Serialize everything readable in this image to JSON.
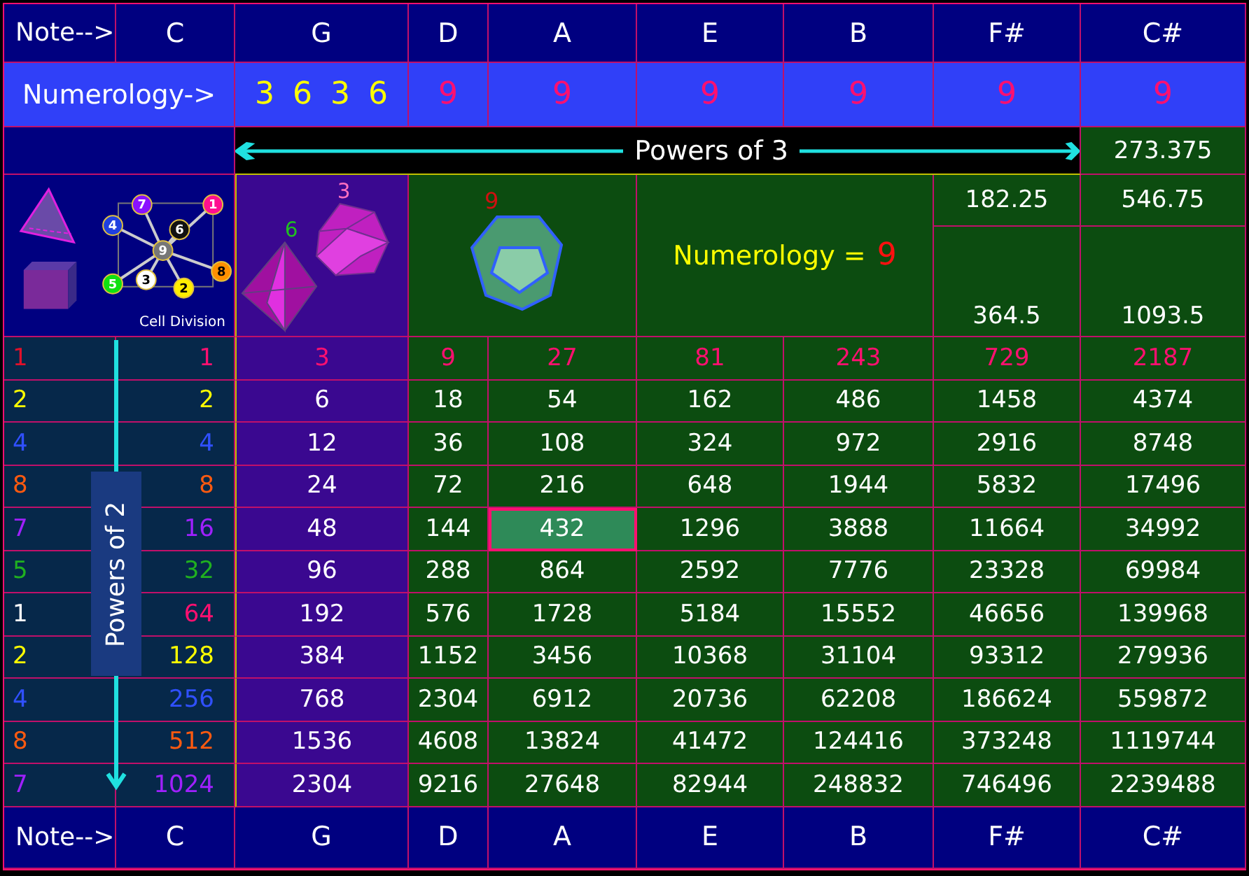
{
  "header": {
    "label": "Note-->",
    "notes": [
      "C",
      "G",
      "D",
      "A",
      "E",
      "B",
      "F#",
      "C#"
    ]
  },
  "numerology": {
    "label": "Numerology->",
    "values": [
      {
        "text": "3 6 3 6",
        "color": "#ffff00"
      },
      {
        "text": "9",
        "color": "#ff1070"
      },
      {
        "text": "9",
        "color": "#ff1070"
      },
      {
        "text": "9",
        "color": "#ff1070"
      },
      {
        "text": "9",
        "color": "#ff1070"
      },
      {
        "text": "9",
        "color": "#ff1070"
      },
      {
        "text": "9",
        "color": "#ff1070"
      }
    ]
  },
  "powers_of_3": {
    "label": "Powers of 3",
    "value": "273.375"
  },
  "figures": {
    "caption": "Cell Division",
    "nodes": [
      {
        "text": "7",
        "color": "#8a10ff"
      },
      {
        "text": "1",
        "color": "#ff1090"
      },
      {
        "text": "4",
        "color": "#2040e0"
      },
      {
        "text": "6",
        "color": "#111111"
      },
      {
        "text": "9",
        "color": "#777777"
      },
      {
        "text": "3",
        "color": "#ffffff"
      },
      {
        "text": "8",
        "color": "#ff9000"
      },
      {
        "text": "5",
        "color": "#10e010"
      },
      {
        "text": "2",
        "color": "#ffee00"
      }
    ],
    "icosahedron_number": "3",
    "octahedron_number": "6",
    "dodecahedron_number": "9"
  },
  "numerology_sum": {
    "label": "Numerology =",
    "value": "9"
  },
  "fractions": {
    "f_sharp": [
      "182.25",
      "364.5"
    ],
    "c_sharp": [
      "546.75",
      "1093.5"
    ]
  },
  "rows": [
    {
      "kind": "base",
      "root": {
        "text": "1",
        "color": "#e0102a"
      },
      "power": {
        "text": "1",
        "color": "#ff1070"
      },
      "values": [
        {
          "text": "3",
          "selected": false
        },
        {
          "text": "9",
          "selected": false
        },
        {
          "text": "27",
          "selected": false
        },
        {
          "text": "81",
          "selected": false
        },
        {
          "text": "243",
          "selected": false
        },
        {
          "text": "729",
          "selected": false
        },
        {
          "text": "2187",
          "selected": false
        }
      ]
    },
    {
      "kind": "multiple",
      "root": {
        "text": "2",
        "color": "#ffff00"
      },
      "power": {
        "text": "2",
        "color": "#ffff00"
      },
      "values": [
        {
          "text": "6",
          "selected": false
        },
        {
          "text": "18",
          "selected": false
        },
        {
          "text": "54",
          "selected": false
        },
        {
          "text": "162",
          "selected": false
        },
        {
          "text": "486",
          "selected": false
        },
        {
          "text": "1458",
          "selected": false
        },
        {
          "text": "4374",
          "selected": false
        }
      ]
    },
    {
      "kind": "multiple",
      "root": {
        "text": "4",
        "color": "#3050ff"
      },
      "power": {
        "text": "4",
        "color": "#3050ff"
      },
      "values": [
        {
          "text": "12",
          "selected": false
        },
        {
          "text": "36",
          "selected": false
        },
        {
          "text": "108",
          "selected": false
        },
        {
          "text": "324",
          "selected": false
        },
        {
          "text": "972",
          "selected": false
        },
        {
          "text": "2916",
          "selected": false
        },
        {
          "text": "8748",
          "selected": false
        }
      ]
    },
    {
      "kind": "multiple",
      "root": {
        "text": "8",
        "color": "#ff5a10"
      },
      "power": {
        "text": "8",
        "color": "#ff5a10"
      },
      "values": [
        {
          "text": "24",
          "selected": false
        },
        {
          "text": "72",
          "selected": false
        },
        {
          "text": "216",
          "selected": false
        },
        {
          "text": "648",
          "selected": false
        },
        {
          "text": "1944",
          "selected": false
        },
        {
          "text": "5832",
          "selected": false
        },
        {
          "text": "17496",
          "selected": false
        }
      ]
    },
    {
      "kind": "multiple",
      "root": {
        "text": "7",
        "color": "#a020ff"
      },
      "power": {
        "text": "16",
        "color": "#a020ff"
      },
      "values": [
        {
          "text": "48",
          "selected": false
        },
        {
          "text": "144",
          "selected": false
        },
        {
          "text": "432",
          "selected": true
        },
        {
          "text": "1296",
          "selected": false
        },
        {
          "text": "3888",
          "selected": false
        },
        {
          "text": "11664",
          "selected": false
        },
        {
          "text": "34992",
          "selected": false
        }
      ]
    },
    {
      "kind": "multiple",
      "root": {
        "text": "5",
        "color": "#20b020"
      },
      "power": {
        "text": "32",
        "color": "#20b020"
      },
      "values": [
        {
          "text": "96",
          "selected": false
        },
        {
          "text": "288",
          "selected": false
        },
        {
          "text": "864",
          "selected": false
        },
        {
          "text": "2592",
          "selected": false
        },
        {
          "text": "7776",
          "selected": false
        },
        {
          "text": "23328",
          "selected": false
        },
        {
          "text": "69984",
          "selected": false
        }
      ]
    },
    {
      "kind": "multiple",
      "root": {
        "text": "1",
        "color": "#ffffff"
      },
      "power": {
        "text": "64",
        "color": "#ff1070"
      },
      "values": [
        {
          "text": "192",
          "selected": false
        },
        {
          "text": "576",
          "selected": false
        },
        {
          "text": "1728",
          "selected": false
        },
        {
          "text": "5184",
          "selected": false
        },
        {
          "text": "15552",
          "selected": false
        },
        {
          "text": "46656",
          "selected": false
        },
        {
          "text": "139968",
          "selected": false
        }
      ]
    },
    {
      "kind": "multiple",
      "root": {
        "text": "2",
        "color": "#ffff00"
      },
      "power": {
        "text": "128",
        "color": "#ffff00"
      },
      "values": [
        {
          "text": "384",
          "selected": false
        },
        {
          "text": "1152",
          "selected": false
        },
        {
          "text": "3456",
          "selected": false
        },
        {
          "text": "10368",
          "selected": false
        },
        {
          "text": "31104",
          "selected": false
        },
        {
          "text": "93312",
          "selected": false
        },
        {
          "text": "279936",
          "selected": false
        }
      ]
    },
    {
      "kind": "multiple",
      "root": {
        "text": "4",
        "color": "#3050ff"
      },
      "power": {
        "text": "256",
        "color": "#3050ff"
      },
      "values": [
        {
          "text": "768",
          "selected": false
        },
        {
          "text": "2304",
          "selected": false
        },
        {
          "text": "6912",
          "selected": false
        },
        {
          "text": "20736",
          "selected": false
        },
        {
          "text": "62208",
          "selected": false
        },
        {
          "text": "186624",
          "selected": false
        },
        {
          "text": "559872",
          "selected": false
        }
      ]
    },
    {
      "kind": "multiple",
      "root": {
        "text": "8",
        "color": "#ff5a10"
      },
      "power": {
        "text": "512",
        "color": "#ff5a10"
      },
      "values": [
        {
          "text": "1536",
          "selected": false
        },
        {
          "text": "4608",
          "selected": false
        },
        {
          "text": "13824",
          "selected": false
        },
        {
          "text": "41472",
          "selected": false
        },
        {
          "text": "124416",
          "selected": false
        },
        {
          "text": "373248",
          "selected": false
        },
        {
          "text": "1119744",
          "selected": false
        }
      ]
    },
    {
      "kind": "multiple",
      "root": {
        "text": "7",
        "color": "#a020ff"
      },
      "power": {
        "text": "1024",
        "color": "#a020ff"
      },
      "values": [
        {
          "text": "2304",
          "selected": false
        },
        {
          "text": "9216",
          "selected": false
        },
        {
          "text": "27648",
          "selected": false
        },
        {
          "text": "82944",
          "selected": false
        },
        {
          "text": "248832",
          "selected": false
        },
        {
          "text": "746496",
          "selected": false
        },
        {
          "text": "2239488",
          "selected": false
        }
      ]
    }
  ],
  "powers_of_2": {
    "label": "Powers of 2"
  },
  "footer": {
    "label": "Note-->",
    "notes": [
      "C",
      "G",
      "D",
      "A",
      "E",
      "B",
      "F#",
      "C#"
    ]
  }
}
